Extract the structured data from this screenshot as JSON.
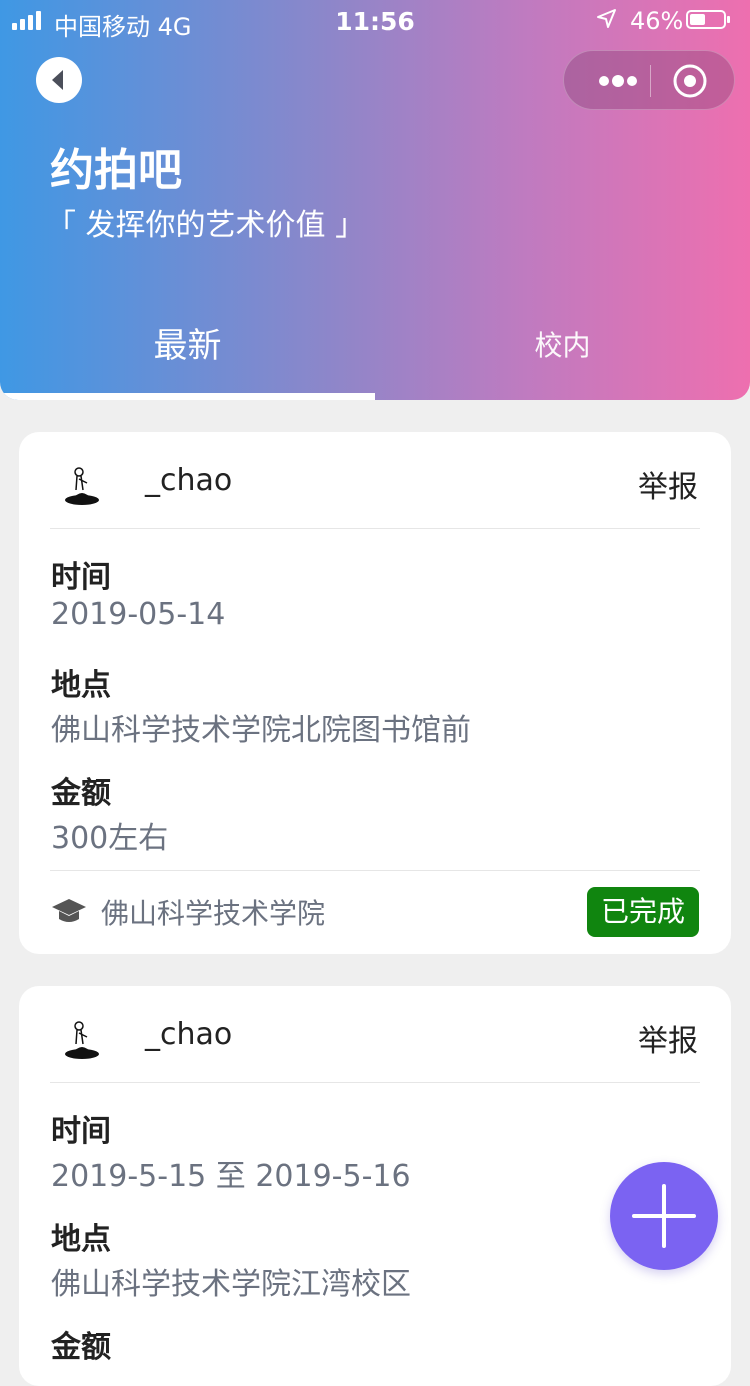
{
  "status_bar": {
    "carrier": "中国移动  4G",
    "time": "11:56",
    "battery_percent": "46%",
    "battery_level": 0.46
  },
  "header": {
    "title": "约拍吧",
    "subtitle": "「 发挥你的艺术价值 」"
  },
  "tabs": [
    {
      "label": "最新",
      "active": true
    },
    {
      "label": "校内",
      "active": false
    }
  ],
  "posts": [
    {
      "author": "_chao",
      "report_label": "举报",
      "time_label": "时间",
      "time_value": "2019-05-14",
      "place_label": "地点",
      "place_value": "佛山科学技术学院北院图书馆前",
      "amount_label": "金额",
      "amount_value": "300左右",
      "school": "佛山科学技术学院",
      "status": "已完成"
    },
    {
      "author": "_chao",
      "report_label": "举报",
      "time_label": "时间",
      "time_value": "2019-5-15 至 2019-5-16",
      "place_label": "地点",
      "place_value": "佛山科学技术学院江湾校区",
      "amount_label": "金额"
    }
  ],
  "colors": {
    "accent": "#7b63f2",
    "status_done": "#10850f"
  }
}
